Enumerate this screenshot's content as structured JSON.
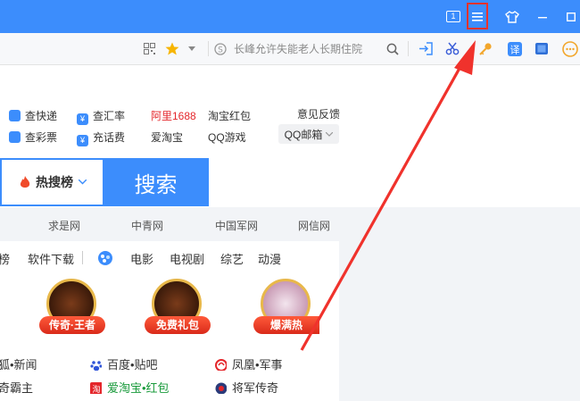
{
  "colors": {
    "brand_blue": "#3c8dfc",
    "arrow_red": "#f0322c",
    "link_red": "#e4262b"
  },
  "titlebar": {
    "tab_count": "1"
  },
  "toolbar": {
    "search_placeholder": "长峰允许失能老人长期住院",
    "icons": [
      "qrcode-icon",
      "star-icon",
      "chevron-down-icon",
      "search-engine-icon",
      "search-icon",
      "login-icon",
      "scissors-icon",
      "key-icon",
      "translate-icon",
      "reader-icon",
      "more-icon"
    ]
  },
  "quicklinks": {
    "kuaidi": "查快递",
    "huilv": "查汇率",
    "caipiao": "查彩票",
    "huafei": "充话费",
    "alibaba": "阿里1688",
    "taobao_hongbao": "淘宝红包",
    "aitaobao": "爱淘宝",
    "qq_game": "QQ游戏",
    "feedback": "意见反馈",
    "qq_mail": "QQ邮箱"
  },
  "search": {
    "hot_label": "热搜榜",
    "button_label": "搜索"
  },
  "sites": [
    "求是网",
    "中青网",
    "中国军网",
    "网信网"
  ],
  "categories": [
    "榜",
    "软件下载",
    "电影",
    "电视剧",
    "综艺",
    "动漫"
  ],
  "ads": [
    "传奇·王者",
    "免费礼包",
    "爆满热"
  ],
  "news": {
    "row1": [
      "狐•新闻",
      "百度•贴吧",
      "凤凰•军事"
    ],
    "row2": [
      "奇霸主",
      "爱淘宝•红包",
      "将军传奇"
    ]
  }
}
